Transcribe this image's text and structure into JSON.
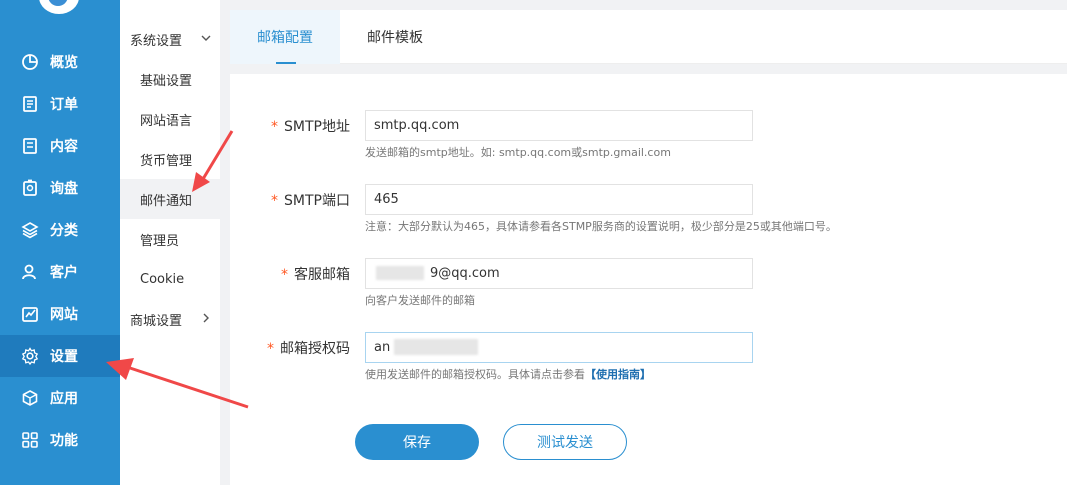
{
  "sidebar": {
    "items": [
      {
        "label": "概览",
        "icon": "pie-chart-icon"
      },
      {
        "label": "订单",
        "icon": "order-list-icon"
      },
      {
        "label": "内容",
        "icon": "content-doc-icon"
      },
      {
        "label": "询盘",
        "icon": "inquiry-icon"
      },
      {
        "label": "分类",
        "icon": "layers-icon"
      },
      {
        "label": "客户",
        "icon": "user-icon"
      },
      {
        "label": "网站",
        "icon": "website-icon"
      },
      {
        "label": "设置",
        "icon": "gear-icon"
      },
      {
        "label": "应用",
        "icon": "cube-icon"
      },
      {
        "label": "功能",
        "icon": "grid-icon"
      }
    ],
    "active_index": 7
  },
  "subnav": {
    "group1": "系统设置",
    "items": [
      "基础设置",
      "网站语言",
      "货币管理",
      "邮件通知",
      "管理员",
      "Cookie"
    ],
    "active_index": 3,
    "group2": "商城设置"
  },
  "tabs": {
    "mail_config": "邮箱配置",
    "mail_template": "邮件模板"
  },
  "form": {
    "smtp_host": {
      "label": "SMTP地址",
      "value": "smtp.qq.com",
      "hint": "发送邮箱的smtp地址。如: smtp.qq.com或smtp.gmail.com"
    },
    "smtp_port": {
      "label": "SMTP端口",
      "value": "465",
      "hint": "注意：大部分默认为465，具体请参看各STMP服务商的设置说明，极少部分是25或其他端口号。"
    },
    "service_email": {
      "label": "客服邮箱",
      "value_visible": "9@qq.com",
      "hint": "向客户发送邮件的邮箱"
    },
    "auth_code": {
      "label": "邮箱授权码",
      "value_visible_prefix": "an",
      "hint": "使用发送邮件的邮箱授权码。具体请点击参看",
      "guide_link": "【使用指南】"
    },
    "required_mark": "*"
  },
  "buttons": {
    "save": "保存",
    "test_send": "测试发送"
  },
  "colors": {
    "sidebar": "#2a8fd0",
    "accent": "#2a8fd0",
    "required": "#ff5722",
    "arrow": "#f04848"
  }
}
